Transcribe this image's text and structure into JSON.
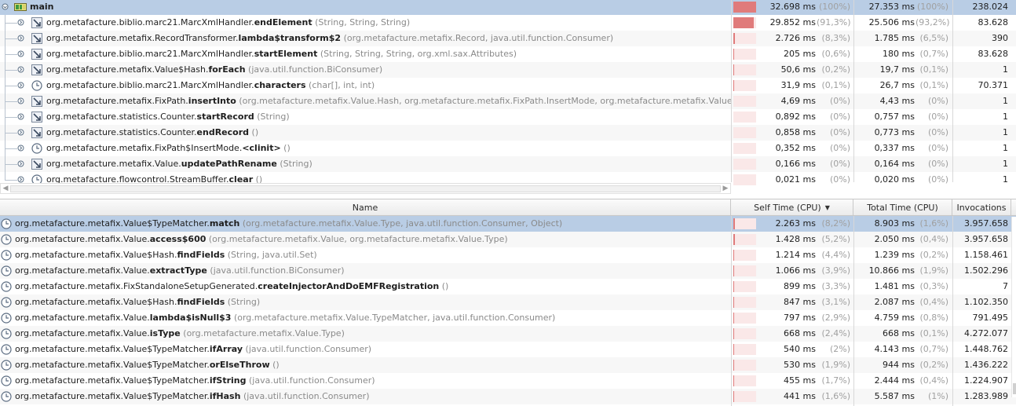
{
  "call_tree": {
    "rows": [
      {
        "name": "main",
        "params": "",
        "icon": "thread-icon",
        "self_time": "32.698 ms",
        "self_pct": "(100%)",
        "total_time": "27.353 ms",
        "total_pct": "(100%)",
        "invocations": "238.024",
        "bar_fraction": 1.0,
        "selected": true
      },
      {
        "pkg": "org.metafacture.biblio.marc21.MarcXmlHandler.",
        "method": "endElement",
        "params": "(String, String, String)",
        "icon": "method-icon",
        "self_time": "29.852 ms",
        "self_pct": "(91,3%)",
        "total_time": "25.506 ms",
        "total_pct": "(93,2%)",
        "invocations": "83.628",
        "bar_fraction": 0.913
      },
      {
        "pkg": "org.metafacture.metafix.RecordTransformer.",
        "method": "lambda$transform$2",
        "params": "(org.metafacture.metafix.Record, java.util.function.Consumer)",
        "icon": "method-icon",
        "self_time": "2.726 ms",
        "self_pct": "(8,3%)",
        "total_time": "1.785 ms",
        "total_pct": "(6,5%)",
        "invocations": "390",
        "bar_fraction": 0.083
      },
      {
        "pkg": "org.metafacture.biblio.marc21.MarcXmlHandler.",
        "method": "startElement",
        "params": "(String, String, String, org.xml.sax.Attributes)",
        "icon": "method-icon",
        "self_time": "205 ms",
        "self_pct": "(0,6%)",
        "total_time": "180 ms",
        "total_pct": "(0,7%)",
        "invocations": "83.628",
        "bar_fraction": 0.006
      },
      {
        "pkg": "org.metafacture.metafix.Value$Hash.",
        "method": "forEach",
        "params": "(java.util.function.BiConsumer)",
        "icon": "method-icon",
        "self_time": "50,6 ms",
        "self_pct": "(0,2%)",
        "total_time": "19,7 ms",
        "total_pct": "(0,1%)",
        "invocations": "1",
        "bar_fraction": 0.002
      },
      {
        "pkg": "org.metafacture.biblio.marc21.MarcXmlHandler.",
        "method": "characters",
        "params": "(char[], int, int)",
        "icon": "clock-icon",
        "self_time": "31,9 ms",
        "self_pct": "(0,1%)",
        "total_time": "26,7 ms",
        "total_pct": "(0,1%)",
        "invocations": "70.371",
        "bar_fraction": 0.001
      },
      {
        "pkg": "org.metafacture.metafix.FixPath.",
        "method": "insertInto",
        "params": "(org.metafacture.metafix.Value.Hash, org.metafacture.metafix.FixPath.InsertMode, org.metafacture.metafix.Value)",
        "icon": "method-icon",
        "self_time": "4,69 ms",
        "self_pct": "(0%)",
        "total_time": "4,43 ms",
        "total_pct": "(0%)",
        "invocations": "1",
        "bar_fraction": 0.0
      },
      {
        "pkg": "org.metafacture.statistics.Counter.",
        "method": "startRecord",
        "params": "(String)",
        "icon": "method-icon",
        "self_time": "0,892 ms",
        "self_pct": "(0%)",
        "total_time": "0,757 ms",
        "total_pct": "(0%)",
        "invocations": "1",
        "bar_fraction": 0.0
      },
      {
        "pkg": "org.metafacture.statistics.Counter.",
        "method": "endRecord",
        "params": "()",
        "icon": "method-icon",
        "self_time": "0,858 ms",
        "self_pct": "(0%)",
        "total_time": "0,773 ms",
        "total_pct": "(0%)",
        "invocations": "1",
        "bar_fraction": 0.0
      },
      {
        "pkg": "org.metafacture.metafix.FixPath$InsertMode.",
        "method": "<clinit>",
        "params": "()",
        "icon": "clock-icon",
        "self_time": "0,352 ms",
        "self_pct": "(0%)",
        "total_time": "0,337 ms",
        "total_pct": "(0%)",
        "invocations": "1",
        "bar_fraction": 0.0
      },
      {
        "pkg": "org.metafacture.metafix.Value.",
        "method": "updatePathRename",
        "params": "(String)",
        "icon": "method-icon",
        "self_time": "0,166 ms",
        "self_pct": "(0%)",
        "total_time": "0,164 ms",
        "total_pct": "(0%)",
        "invocations": "1",
        "bar_fraction": 0.0
      },
      {
        "pkg": "org.metafacture.flowcontrol.StreamBuffer.",
        "method": "clear",
        "params": "()",
        "icon": "clock-icon",
        "self_time": "0,021 ms",
        "self_pct": "(0%)",
        "total_time": "0,020 ms",
        "total_pct": "(0%)",
        "invocations": "1",
        "bar_fraction": 0.0
      }
    ]
  },
  "hotspots": {
    "columns": {
      "name": "Name",
      "self_time": "Self Time (CPU)",
      "total_time": "Total Time (CPU)",
      "invocations": "Invocations"
    },
    "sort_column": "self_time",
    "rows": [
      {
        "pkg": "org.metafacture.metafix.Value$TypeMatcher.",
        "method": "match",
        "params": "(org.metafacture.metafix.Value.Type, java.util.function.Consumer, Object)",
        "self_time": "2.263 ms",
        "self_pct": "(8,2%)",
        "total_time": "8.903 ms",
        "total_pct": "(1,6%)",
        "invocations": "3.957.658",
        "bar_fraction": 0.082,
        "selected": true
      },
      {
        "pkg": "org.metafacture.metafix.Value.",
        "method": "access$600",
        "params": "(org.metafacture.metafix.Value, org.metafacture.metafix.Value.Type)",
        "self_time": "1.428 ms",
        "self_pct": "(5,2%)",
        "total_time": "2.050 ms",
        "total_pct": "(0,4%)",
        "invocations": "3.957.658",
        "bar_fraction": 0.052
      },
      {
        "pkg": "org.metafacture.metafix.Value$Hash.",
        "method": "findFields",
        "params": "(String, java.util.Set)",
        "self_time": "1.214 ms",
        "self_pct": "(4,4%)",
        "total_time": "1.239 ms",
        "total_pct": "(0,2%)",
        "invocations": "1.158.461",
        "bar_fraction": 0.044
      },
      {
        "pkg": "org.metafacture.metafix.Value.",
        "method": "extractType",
        "params": "(java.util.function.BiConsumer)",
        "self_time": "1.066 ms",
        "self_pct": "(3,9%)",
        "total_time": "10.866 ms",
        "total_pct": "(1,9%)",
        "invocations": "1.502.296",
        "bar_fraction": 0.039
      },
      {
        "pkg": "org.metafacture.metafix.FixStandaloneSetupGenerated.",
        "method": "createInjectorAndDoEMFRegistration",
        "params": "()",
        "self_time": "899 ms",
        "self_pct": "(3,3%)",
        "total_time": "1.481 ms",
        "total_pct": "(0,3%)",
        "invocations": "7",
        "bar_fraction": 0.033
      },
      {
        "pkg": "org.metafacture.metafix.Value$Hash.",
        "method": "findFields",
        "params": "(String)",
        "self_time": "847 ms",
        "self_pct": "(3,1%)",
        "total_time": "2.087 ms",
        "total_pct": "(0,4%)",
        "invocations": "1.102.350",
        "bar_fraction": 0.031
      },
      {
        "pkg": "org.metafacture.metafix.Value.",
        "method": "lambda$isNull$3",
        "params": "(org.metafacture.metafix.Value.TypeMatcher, java.util.function.Consumer)",
        "self_time": "797 ms",
        "self_pct": "(2,9%)",
        "total_time": "4.759 ms",
        "total_pct": "(0,8%)",
        "invocations": "791.495",
        "bar_fraction": 0.029
      },
      {
        "pkg": "org.metafacture.metafix.Value.",
        "method": "isType",
        "params": "(org.metafacture.metafix.Value.Type)",
        "self_time": "668 ms",
        "self_pct": "(2,4%)",
        "total_time": "668 ms",
        "total_pct": "(0,1%)",
        "invocations": "4.272.077",
        "bar_fraction": 0.024
      },
      {
        "pkg": "org.metafacture.metafix.Value$TypeMatcher.",
        "method": "ifArray",
        "params": "(java.util.function.Consumer)",
        "self_time": "540 ms",
        "self_pct": "(2%)",
        "total_time": "4.143 ms",
        "total_pct": "(0,7%)",
        "invocations": "1.448.762",
        "bar_fraction": 0.02
      },
      {
        "pkg": "org.metafacture.metafix.Value$TypeMatcher.",
        "method": "orElseThrow",
        "params": "()",
        "self_time": "530 ms",
        "self_pct": "(1,9%)",
        "total_time": "944 ms",
        "total_pct": "(0,2%)",
        "invocations": "1.436.222",
        "bar_fraction": 0.019
      },
      {
        "pkg": "org.metafacture.metafix.Value$TypeMatcher.",
        "method": "ifString",
        "params": "(java.util.function.Consumer)",
        "self_time": "455 ms",
        "self_pct": "(1,7%)",
        "total_time": "2.444 ms",
        "total_pct": "(0,4%)",
        "invocations": "1.224.907",
        "bar_fraction": 0.017
      },
      {
        "pkg": "org.metafacture.metafix.Value$TypeMatcher.",
        "method": "ifHash",
        "params": "(java.util.function.Consumer)",
        "self_time": "441 ms",
        "self_pct": "(1,6%)",
        "total_time": "5.587 ms",
        "total_pct": "(1%)",
        "invocations": "1.283.989",
        "bar_fraction": 0.016
      }
    ]
  },
  "colors": {
    "selection": "#b9cde5",
    "bar_fill": "#e07b7b",
    "bar_track": "#fae8e8"
  }
}
